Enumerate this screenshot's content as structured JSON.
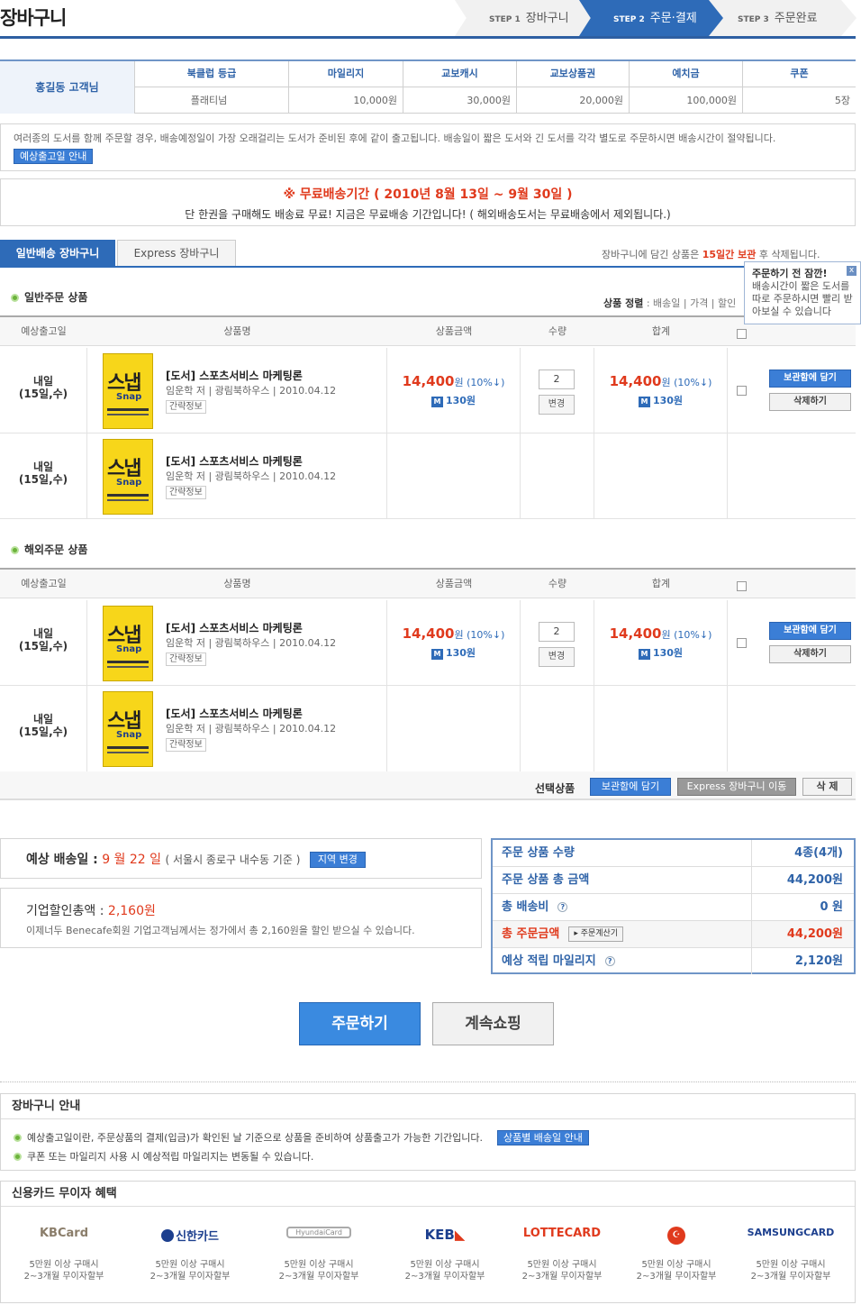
{
  "page_title": "장바구니",
  "steps": [
    {
      "num": "STEP 1",
      "label": "장바구니"
    },
    {
      "num": "STEP 2",
      "label": "주문·결제"
    },
    {
      "num": "STEP 3",
      "label": "주문완료"
    }
  ],
  "member": {
    "name": "홍길동 고객님",
    "columns": [
      {
        "header": "북클럽 등급",
        "value": "플래티넘"
      },
      {
        "header": "마일리지",
        "value": "10,000원"
      },
      {
        "header": "교보캐시",
        "value": "30,000원"
      },
      {
        "header": "교보상품권",
        "value": "20,000원"
      },
      {
        "header": "예치금",
        "value": "100,000원"
      },
      {
        "header": "쿠폰",
        "value": "5장"
      }
    ]
  },
  "notice1": {
    "text": "여러종의 도서를 함께 주문할 경우, 배송예정일이 가장 오래걸리는 도서가 준비된 후에 같이 출고됩니다.  배송일이 짧은 도서와 긴 도서를 각각 별도로 주문하시면 배송시간이 절약됩니다.",
    "button": "예상출고일 안내"
  },
  "notice2": {
    "title": "※ 무료배송기간 ( 2010년 8월 13일 ~ 9월 30일 )",
    "text": "단 한권을 구매해도 배송료 무료! 지금은 무료배송 기간입니다! ( 해외배송도서는 무료배송에서 제외됩니다.)"
  },
  "tabs": {
    "normal": "일반배송 장바구니",
    "express": "Express 장바구니"
  },
  "keep_note": {
    "pre": "장바구니에 담긴 상품은 ",
    "bold": "15일간 보관",
    "post": " 후 삭제됩니다."
  },
  "tooltip": {
    "title": "주문하기 전 잠깐!",
    "text": "배송시간이 짧은 도서를 따로 주문하시면 빨리 받아보실 수 있습니다",
    "close": "x"
  },
  "sort": {
    "label": "상품 정렬",
    "options": ": 배송일 | 가격 | 할인"
  },
  "sections": [
    {
      "title": "일반주문 상품"
    },
    {
      "title": "해외주문 상품"
    }
  ],
  "table_headers": [
    "예상출고일",
    "상품명",
    "상품금액",
    "수량",
    "합계"
  ],
  "item": {
    "date_line1": "내일",
    "date_line2": "(15일,수)",
    "name": "[도서] 스포츠서비스 마케팅론",
    "author": "임운학 저 | 광림북하우스 | 2010.04.12",
    "info_button": "간략정보",
    "cover_title": "스냅",
    "cover_sub": "Snap",
    "price": "14,400",
    "price_unit": "원",
    "discount": " (10%↓)",
    "mileage": "130원",
    "mileage_icon": "M",
    "qty": "2",
    "qty_button": "변경",
    "keep_button": "보관함에 담기",
    "delete_button": "삭제하기"
  },
  "selection_bar": {
    "label": "선택상품",
    "keep": "보관함에 담기",
    "express": "Express 장바구니 이동",
    "delete": "삭 제"
  },
  "delivery": {
    "label": "예상 배송일 :",
    "date": "9 월 22 일",
    "detail": "( 서울시 종로구 내수동 기준 )",
    "button": "지역 변경"
  },
  "corp_discount": {
    "label": "기업할인총액 : ",
    "amount": "2,160원",
    "text": "이제너두 Benecafe회원 기업고객님께서는 정가에서 총 2,160원을 할인 받으실 수 있습니다."
  },
  "summary": [
    {
      "label": "주문 상품 수량",
      "value": "4종(4개)"
    },
    {
      "label": "주문 상품 총 금액",
      "value": "44,200원"
    },
    {
      "label": "총 배송비",
      "value": "0 원"
    },
    {
      "label": "총 주문금액",
      "value": "44,200원",
      "button": "▸ 주문계산기"
    },
    {
      "label": "예상 적립 마일리지",
      "value": "2,120원"
    }
  ],
  "buttons": {
    "order": "주문하기",
    "continue": "계속쇼핑"
  },
  "guide": {
    "title": "장바구니 안내",
    "items": [
      "예상출고일이란, 주문상품의 결제(입금)가 확인된 날 기준으로 상품을 준비하여 상품출고가 가능한 기간입니다.",
      "쿠폰 또는 마일리지 사용 시 예상적립 마일리지는 변동될 수 있습니다."
    ],
    "button": "상품별 배송일 안내"
  },
  "cards": {
    "title": "신용카드 무이자 혜택",
    "list": [
      {
        "name": "KBCard",
        "color": "#8a7d6a",
        "desc1": "5만원 이상 구매시",
        "desc2": "2~3개월 무이자할부"
      },
      {
        "name": "신한카드",
        "color": "#1c3f8e",
        "desc1": "5만원 이상 구매시",
        "desc2": "2~3개월 무이자할부"
      },
      {
        "name": "HyundaiCard",
        "color": "#888888",
        "desc1": "5만원 이상 구매시",
        "desc2": "2~3개월 무이자할부"
      },
      {
        "name": "KEB",
        "color": "#1c3f8e",
        "desc1": "5만원 이상 구매시",
        "desc2": "2~3개월 무이자할부"
      },
      {
        "name": "LOTTECARD",
        "color": "#e03a1d",
        "desc1": "5만원 이상 구매시",
        "desc2": "2~3개월 무이자할부"
      },
      {
        "name": "",
        "color": "#e03a1d",
        "desc1": "5만원 이상 구매시",
        "desc2": "2~3개월 무이자할부"
      },
      {
        "name": "SAMSUNGCARD",
        "color": "#1c3f8e",
        "desc1": "5만원 이상 구매시",
        "desc2": "2~3개월 무이자할부"
      }
    ]
  }
}
